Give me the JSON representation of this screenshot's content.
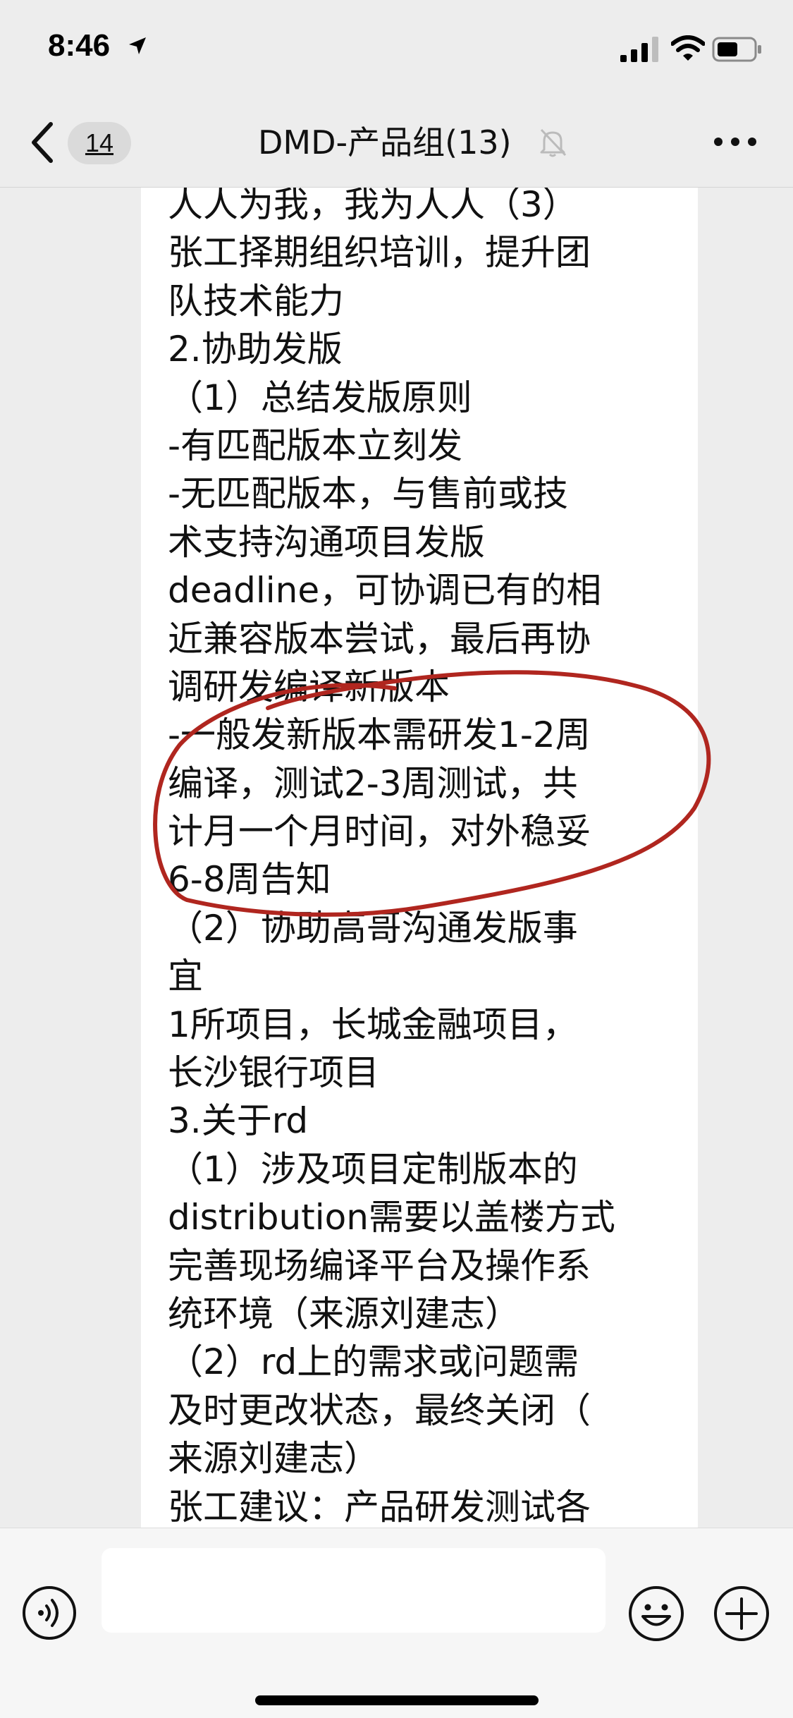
{
  "status_bar": {
    "time": "8:46",
    "location_icon": "location-arrow-icon",
    "signal_icon": "cellular-signal-icon",
    "wifi_icon": "wifi-icon",
    "battery_icon": "battery-icon"
  },
  "nav": {
    "back_icon": "chevron-left-icon",
    "unread_count": "14",
    "title": "DMD-产品组(13)",
    "mute_icon": "muted-bell-icon",
    "more_icon": "more-dots-icon"
  },
  "message": {
    "lines": [
      "人人为我，我为人人（3）",
      "张工择期组织培训，提升团",
      "队技术能力",
      "2.协助发版",
      "（1）总结发版原则",
      "-有匹配版本立刻发",
      "-无匹配版本，与售前或技",
      "术支持沟通项目发版",
      "deadline，可协调已有的相",
      "近兼容版本尝试，最后再协",
      "调研发编译新版本",
      "-一般发新版本需研发1-2周",
      "编译，测试2-3周测试，共",
      "计月一个月时间，对外稳妥",
      "6-8周告知",
      "（2）协助高哥沟通发版事",
      "宜",
      "1所项目，长城金融项目，",
      "长沙银行项目",
      "3.关于rd",
      "（1）涉及项目定制版本的",
      "distribution需要以盖楼方式",
      "完善现场编译平台及操作系",
      "统环境（来源刘建志）",
      "（2）rd上的需求或问题需",
      "及时更改状态，最终关闭（",
      "来源刘建志）",
      "张工建议：产品研发测试各"
    ],
    "annotation_color": "#b0261f"
  },
  "input_bar": {
    "voice_icon": "voice-input-icon",
    "text_value": "",
    "emoji_icon": "emoji-icon",
    "plus_icon": "plus-icon"
  }
}
